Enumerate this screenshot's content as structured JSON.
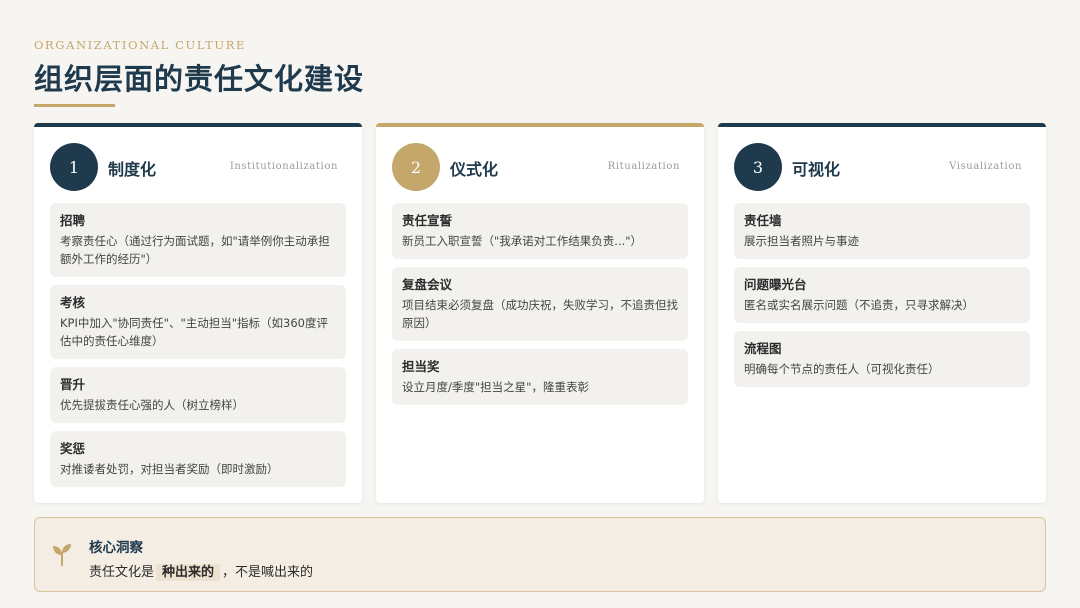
{
  "header": {
    "eyebrow": "ORGANIZATIONAL CULTURE",
    "title": "组织层面的责任文化建设"
  },
  "colors": {
    "navy": "#1f3a4d",
    "gold": "#c5a66b",
    "background": "#f6f5f2"
  },
  "cards": [
    {
      "number": "1",
      "title": "制度化",
      "subtitle": "Institutionalization",
      "items": [
        {
          "title": "招聘",
          "desc": "考察责任心（通过行为面试题，如\"请举例你主动承担额外工作的经历\"）"
        },
        {
          "title": "考核",
          "desc": "KPI中加入\"协同责任\"、\"主动担当\"指标（如360度评估中的责任心维度）"
        },
        {
          "title": "晋升",
          "desc": "优先提拔责任心强的人（树立榜样）"
        },
        {
          "title": "奖惩",
          "desc": "对推诿者处罚，对担当者奖励（即时激励）"
        }
      ]
    },
    {
      "number": "2",
      "title": "仪式化",
      "subtitle": "Ritualization",
      "items": [
        {
          "title": "责任宣誓",
          "desc": "新员工入职宣誓（\"我承诺对工作结果负责...\"）"
        },
        {
          "title": "复盘会议",
          "desc": "项目结束必须复盘（成功庆祝，失败学习，不追责但找原因）"
        },
        {
          "title": "担当奖",
          "desc": "设立月度/季度\"担当之星\"，隆重表彰"
        }
      ]
    },
    {
      "number": "3",
      "title": "可视化",
      "subtitle": "Visualization",
      "items": [
        {
          "title": "责任墙",
          "desc": "展示担当者照片与事迹"
        },
        {
          "title": "问题曝光台",
          "desc": "匿名或实名展示问题（不追责，只寻求解决）"
        },
        {
          "title": "流程图",
          "desc": "明确每个节点的责任人（可视化责任）"
        }
      ]
    }
  ],
  "insight": {
    "icon": "sprout-icon",
    "title": "核心洞察",
    "text_before": "责任文化是",
    "highlight": "种出来的",
    "text_after": "，不是喊出来的"
  }
}
